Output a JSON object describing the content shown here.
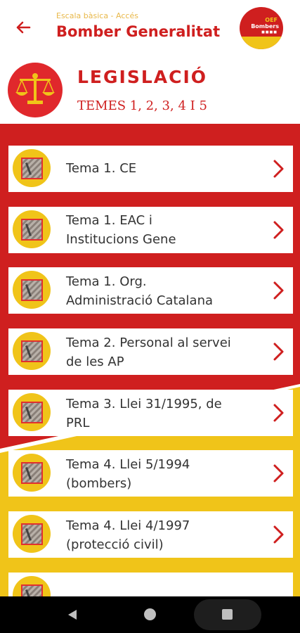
{
  "appbar": {
    "subtitle": "Escala bàsica - Accés",
    "title": "Bomber Generalitat",
    "logo_text_top": "OEF",
    "logo_text_main": "Bombers",
    "logo_dots": "■■■■"
  },
  "section": {
    "title": "LEGISLACIÓ",
    "subtitle": "TEMES 1, 2, 3, 4 I 5"
  },
  "items": [
    {
      "line1": "Tema 1. CE",
      "line2": ""
    },
    {
      "line1": "Tema 1. EAC i",
      "line2": "Institucions Gene"
    },
    {
      "line1": "Tema 1. Org.",
      "line2": "Administració Catalana"
    },
    {
      "line1": "Tema 2. Personal al servei",
      "line2": "de les AP"
    },
    {
      "line1": "Tema 3. Llei 31/1995, de",
      "line2": "PRL"
    },
    {
      "line1": "Tema 4. Llei 5/1994",
      "line2": "(bombers)"
    },
    {
      "line1": "Tema 4. Llei 4/1997",
      "line2": "(protecció civil)"
    }
  ],
  "colors": {
    "primary_red": "#cf1f1f",
    "accent_yellow": "#f0c419",
    "subtitle_yellow": "#e8b84a"
  },
  "icons": {
    "back": "arrow-left-icon",
    "section": "balance-scale-icon",
    "item": "flag-icon",
    "chevron": "chevron-right-icon"
  }
}
